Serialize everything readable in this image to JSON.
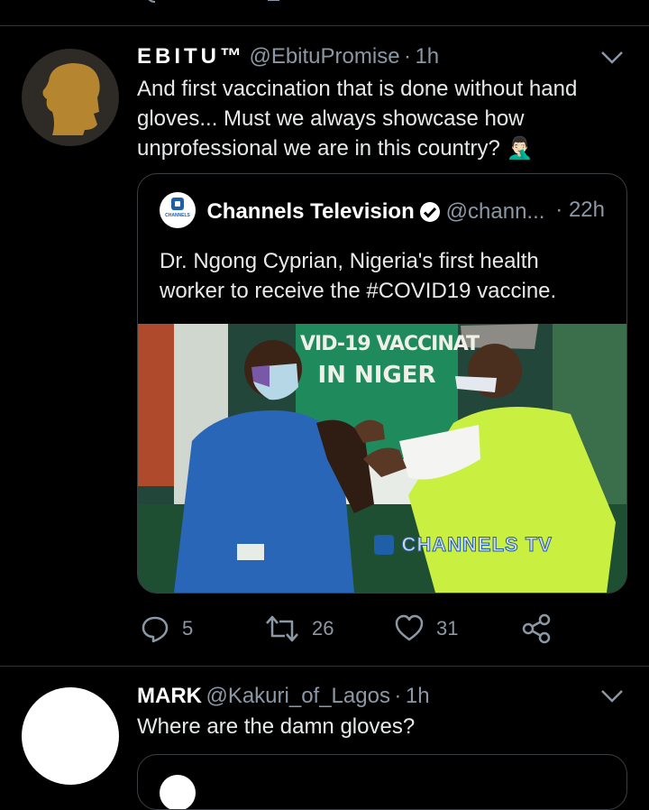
{
  "tweet": {
    "display_name": "EBITU™",
    "handle": "@EbituPromise",
    "separator": "·",
    "time": "1h",
    "text_lines": [
      "And first vaccination that is done without hand",
      "gloves... Must we always showcase how",
      "unprofessional we are in this country?"
    ],
    "emoji": "🤦🏻‍♂️",
    "quote": {
      "display_name": "Channels Television",
      "handle": "@chann...",
      "time": "· 22h",
      "logo_text": "CHANNELS",
      "text_lines": [
        "Dr. Ngong Cyprian, Nigeria's first health",
        "worker to receive the #COVID19 vaccine."
      ],
      "image": {
        "banner_line1": "VID-19 VACCINAT",
        "banner_line2": "IN NIGER",
        "watermark": "CHANNELS TV"
      }
    },
    "actions": {
      "reply_count": "5",
      "retweet_count": "26",
      "like_count": "31"
    }
  },
  "reply": {
    "display_name": "MARK",
    "handle": "@Kakuri_of_Lagos",
    "separator": "·",
    "time": "1h",
    "text": "Where are the damn gloves?"
  },
  "colors": {
    "background": "#000000",
    "secondary_text": "#8b98a5",
    "divider": "#2f3336"
  }
}
